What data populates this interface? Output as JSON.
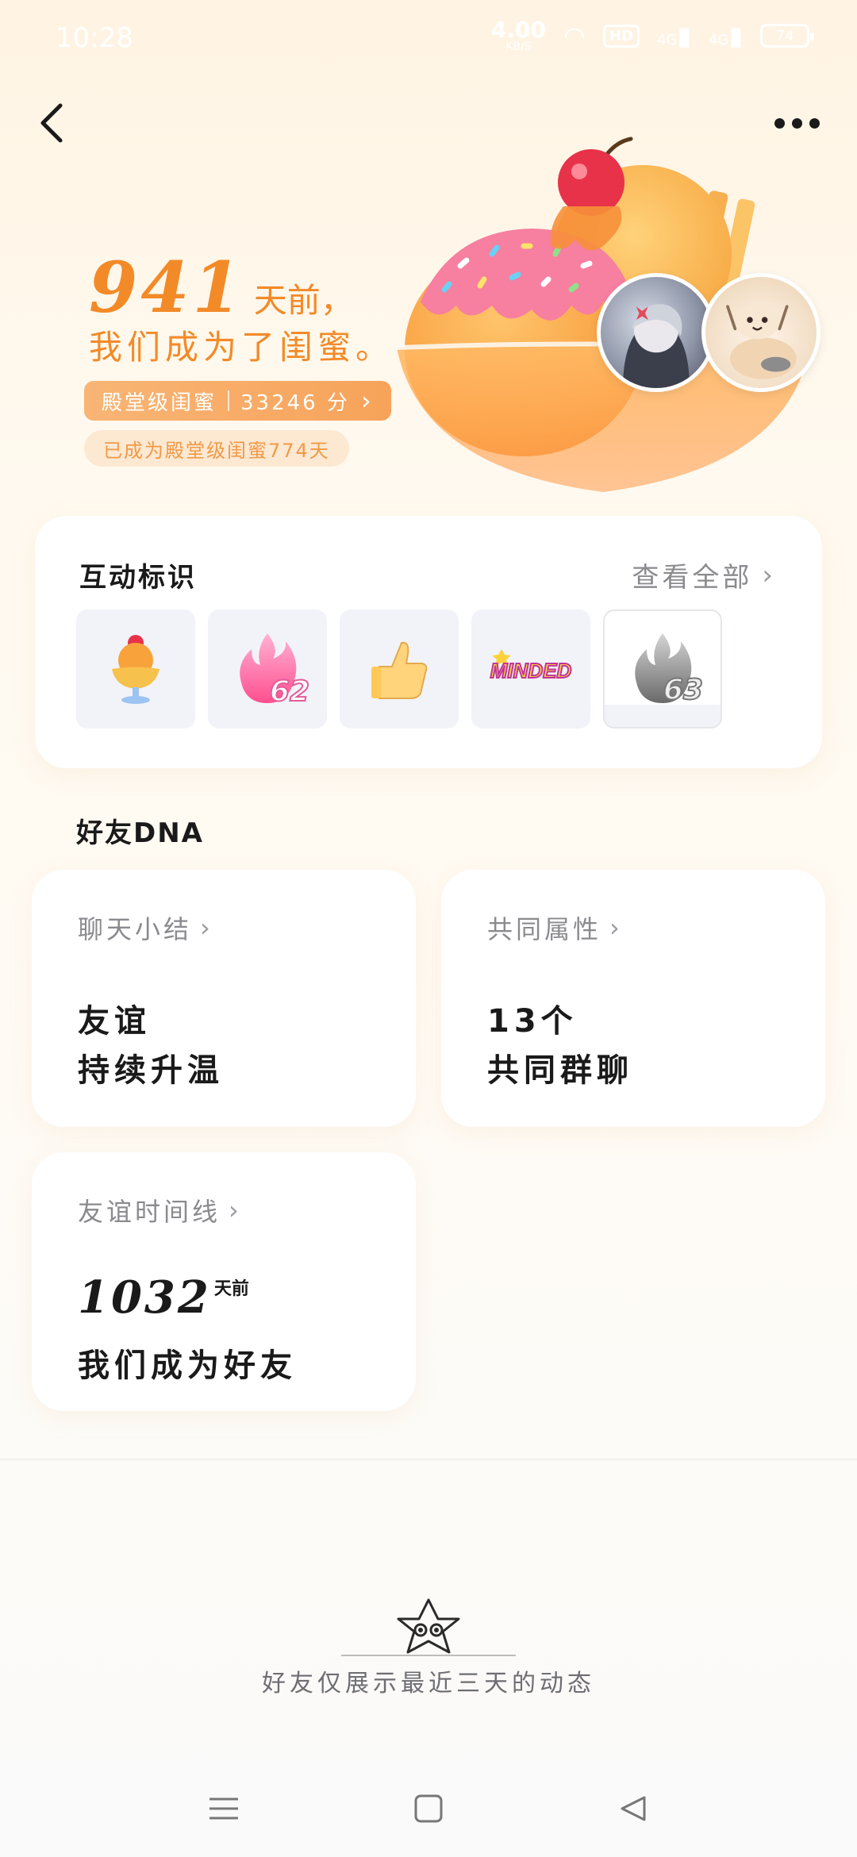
{
  "status_bar": {
    "time": "10:28",
    "net_speed": "4.00",
    "net_unit": "KB/S",
    "hd": "HD",
    "signal_1": "4G",
    "signal_2": "4G",
    "battery": "74"
  },
  "nav": {
    "back_icon": "chevron-left-icon",
    "more_icon": "more-dots-icon"
  },
  "hero": {
    "days_number": "941",
    "days_suffix": "天前，",
    "subtitle": "我们成为了闺蜜。",
    "level_label": "殿堂级闺蜜",
    "level_score": "33246 分",
    "level_duration": "已成为殿堂级闺蜜774天"
  },
  "interaction": {
    "title": "互动标识",
    "view_all": "查看全部",
    "badges": [
      {
        "name": "sundae-badge-icon"
      },
      {
        "name": "fire-badge-icon",
        "number": "62"
      },
      {
        "name": "thumbs-up-badge-icon"
      },
      {
        "name": "minded-badge-icon",
        "text": "MINDED"
      },
      {
        "name": "grey-fire-badge-icon",
        "number": "63"
      }
    ]
  },
  "dna": {
    "title": "好友DNA",
    "chat_summary": {
      "label": "聊天小结",
      "line1": "友谊",
      "line2": "持续升温"
    },
    "common_attr": {
      "label": "共同属性",
      "line1": "13个",
      "line2": "共同群聊"
    },
    "timeline": {
      "label": "友谊时间线",
      "number": "1032",
      "suffix": "天前",
      "line": "我们成为好友"
    }
  },
  "feed": {
    "empty_text": "好友仅展示最近三天的动态"
  },
  "colors": {
    "accent": "#f38a28",
    "pill": "#f7a35a",
    "pill_light": "#fde8d2",
    "muted_text": "#8a8a8f"
  }
}
